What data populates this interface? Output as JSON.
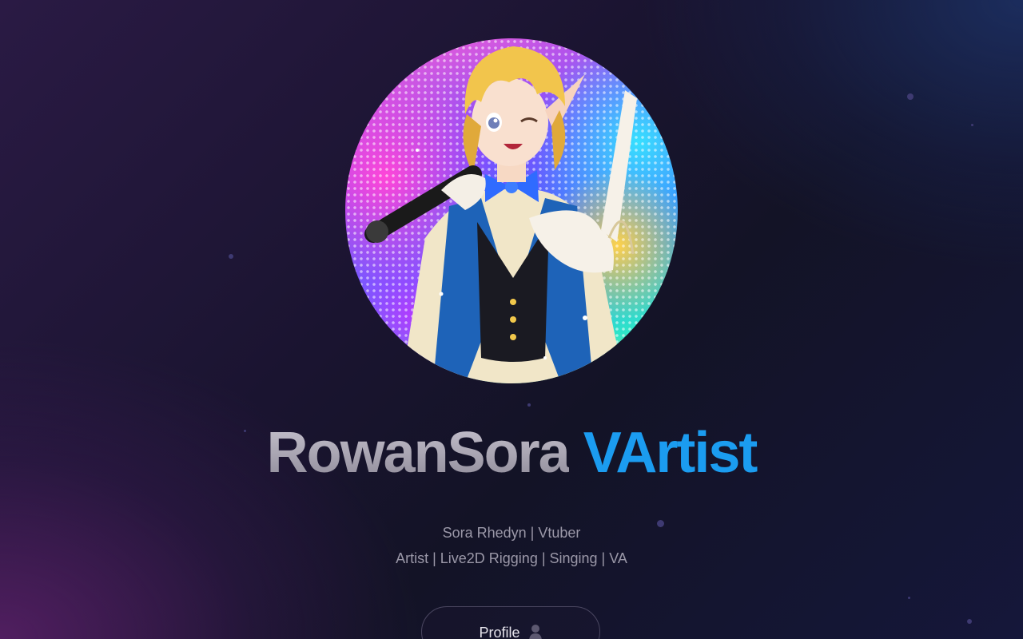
{
  "avatar": {
    "alt": "RowanSora VArtist avatar"
  },
  "title": {
    "name": "RowanSora",
    "accent": "VArtist"
  },
  "subtitle": {
    "line1": "Sora Rhedyn | Vtuber",
    "line2": "Artist | Live2D Rigging | Singing | VA"
  },
  "profile_button": {
    "label": "Profile",
    "icon": "person-icon"
  },
  "colors": {
    "accent": "#1b9cf0",
    "text_muted": "#9b98a8",
    "background_dark": "#131326"
  }
}
